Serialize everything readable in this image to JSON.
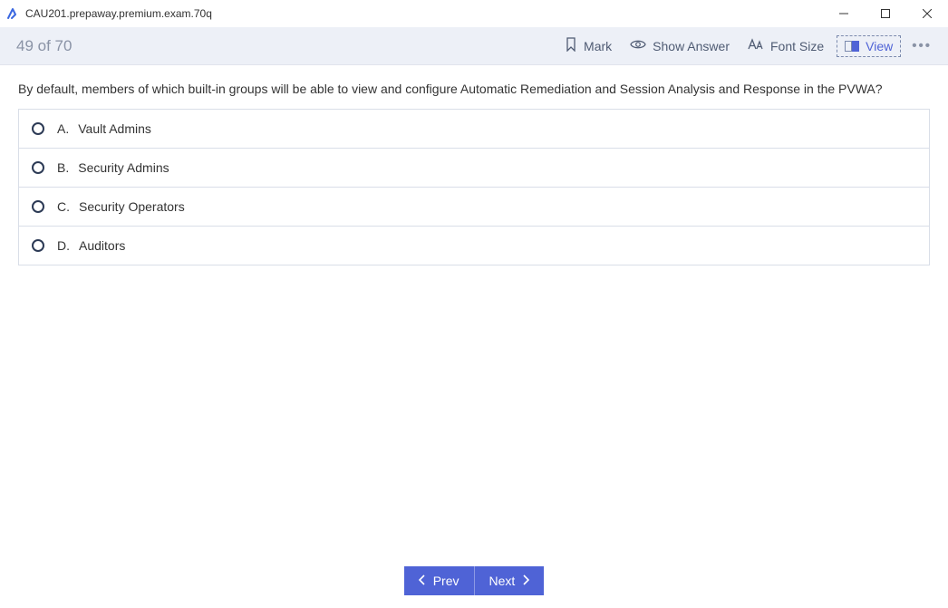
{
  "window": {
    "title": "CAU201.prepaway.premium.exam.70q"
  },
  "toolbar": {
    "counter": "49 of 70",
    "mark_label": "Mark",
    "show_answer_label": "Show Answer",
    "font_size_label": "Font Size",
    "view_label": "View",
    "more_label": "•••"
  },
  "question": {
    "text": "By default, members of which built-in groups will be able to view and configure Automatic Remediation and Session Analysis and Response in the PVWA?",
    "answers": [
      {
        "letter": "A.",
        "text": "Vault Admins"
      },
      {
        "letter": "B.",
        "text": "Security Admins"
      },
      {
        "letter": "C.",
        "text": "Security Operators"
      },
      {
        "letter": "D.",
        "text": "Auditors"
      }
    ]
  },
  "footer": {
    "prev_label": "Prev",
    "next_label": "Next"
  }
}
